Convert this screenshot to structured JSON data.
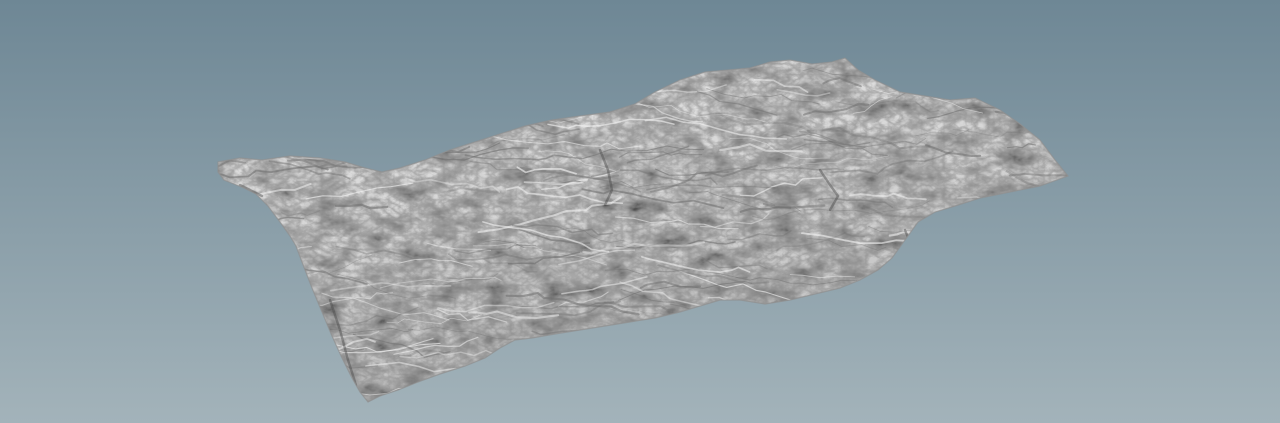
{
  "viewport": {
    "background_top": "#6e8795",
    "background_bottom": "#a3b3ba",
    "mesh_highlight": "#e6e6e6",
    "mesh_midtone": "#bdbdbd",
    "mesh_shadow": "#707070",
    "mesh_crevice": "#4a4a4a"
  },
  "terrain": {
    "object_name": "terrain-heightfield-mesh",
    "shading": "flat grey clay"
  }
}
